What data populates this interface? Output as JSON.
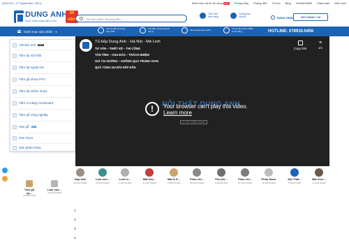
{
  "topbar": {
    "notice": "(543 003 - 27 September, 2021)",
    "links": [
      {
        "label": "Định mức vật tư thi công",
        "badge": "NEW"
      },
      {
        "label": "Phong thủy",
        "badge": ""
      },
      {
        "label": "Phòng 360",
        "badge": ""
      },
      {
        "label": "Tin tức",
        "badge": ""
      },
      {
        "label": "Blog",
        "badge": ""
      },
      {
        "label": "DUANHOME",
        "badge": ""
      },
      {
        "label": "Flash sale",
        "badge": ""
      },
      {
        "label": "Mới cuộn",
        "badge": ""
      }
    ]
  },
  "header": {
    "logo_name": "DUNG ANH",
    "logo_tagline": "NHÂN THIÊN NHIÊN BỀN VỮNG",
    "logo_badge": "20 năm",
    "search_placeholder": "Tìm sản phẩm, thương hiệu...",
    "icons": [
      {
        "name": "Theo dõi đơn hàng"
      },
      {
        "name": "Thông báo của tôi"
      }
    ],
    "login_label": "ĐĂNG NHẬP",
    "cart_label": "GIỎ HÀNG / 0đ"
  },
  "navbar": {
    "category_button": "Danh mục sản phẩm",
    "features": [
      {
        "text": "Hướng dẫn sử dụng sản phẩm"
      },
      {
        "text": "Tiết kiệm chi phí giá tốt hợp lý"
      },
      {
        "text": "Vận chuyển toàn quốc"
      },
      {
        "text": "Tốt và sản phẩm 100% chính hãng"
      }
    ],
    "hotline": "HOTLINE: 078910.0456"
  },
  "menu": {
    "items": [
      {
        "label": "Vật liệu mới",
        "badge": "NEW",
        "badge_type": "new",
        "arrow": false
      },
      {
        "label": "Tấm ốp nội thất",
        "badge": "",
        "badge_type": "",
        "arrow": true
      },
      {
        "label": "Tấm ốp ngoài trời",
        "badge": "",
        "badge_type": "",
        "arrow": true
      },
      {
        "label": "Tấm gỗ nhựa PVC",
        "badge": "",
        "badge_type": "",
        "arrow": true
      },
      {
        "label": "Tấm ốp nhôm nhựa",
        "badge": "",
        "badge_type": "",
        "arrow": true
      },
      {
        "label": "Tấm xi măng Cemboard",
        "badge": "",
        "badge_type": "",
        "arrow": true
      },
      {
        "label": "Tấm gỗ công nghiệp",
        "badge": "",
        "badge_type": "",
        "arrow": true
      },
      {
        "label": "Sàn gỗ",
        "badge": "Sale",
        "badge_type": "sale",
        "arrow": false
      },
      {
        "label": "Sàn nhựa",
        "badge": "",
        "badge_type": "",
        "arrow": false
      },
      {
        "label": "Sản phẩm khác",
        "badge": "",
        "badge_type": "",
        "arrow": false
      }
    ]
  },
  "video": {
    "title": "Tủ bếp Dung Anh - Hà Nội - Mê Linh",
    "lines": [
      "TƯ VẤN – THIẾT KẾ – THI CÔNG",
      "TẬN TÌNH – CHU ĐÁO – TRÁCH NHIỆM",
      "GIÁ TẠI XƯỞNG – KHÔNG QUA TRUNG GIAN",
      "QUÀ TẶNG ƯU ĐÃI HẤP DẪN"
    ],
    "copy_label": "Copy link",
    "pager": "1/1",
    "error_message": "Your browser can't play this video.",
    "learn_more": "Learn more",
    "watermark": "NỘI THẤT DUNG ANH",
    "watermark_sub": "UY TÍN • CHẤT LƯỢNG"
  },
  "side_products": [
    {
      "name": "Tấm gỗ ốp...",
      "count": "4 SẢN PHẨM"
    },
    {
      "name": "Lam nhô...",
      "count": "12 SẢN PHẨM"
    }
  ],
  "products": [
    {
      "name": "Nẹp trần",
      "count": "24 SẢN PHẨM",
      "color": "#9a8f86"
    },
    {
      "name": "Lam sơn...",
      "count": "16 SẢN PHẨM",
      "color": "#3e8f8f"
    },
    {
      "name": "Lưới tr...",
      "count": "3 SẢN PHẨM",
      "color": "#b0b0b0"
    },
    {
      "name": "Mặt bốc...",
      "count": "11 SẢN PHẨM",
      "color": "#c33e3e"
    },
    {
      "name": "Mặt & K...",
      "count": "5 SẢN PHẨM",
      "color": "#c9a46a"
    },
    {
      "name": "Phào chỉ...",
      "count": "28 SẢN PHẨM",
      "color": "#8a8a8a"
    },
    {
      "name": "Phụ kiệ...",
      "count": "9 SẢN PHẨM",
      "color": "#6f6f6f"
    },
    {
      "name": "Phào chỉ...",
      "count": "14 SẢN PHẨM",
      "color": "#7c7c7c"
    },
    {
      "name": "Phào Nano",
      "count": "12 SẢN PHẨM",
      "color": "#bdbdbd"
    },
    {
      "name": "Nội Thất...",
      "count": "6 SẢN PHẨM",
      "color": "#1b63b4"
    },
    {
      "name": "Bàn tron...",
      "count": "11 SẢN PHẨM",
      "color": "#6b5a4a"
    }
  ],
  "numbers": [
    "1",
    "2",
    "3",
    "4"
  ]
}
